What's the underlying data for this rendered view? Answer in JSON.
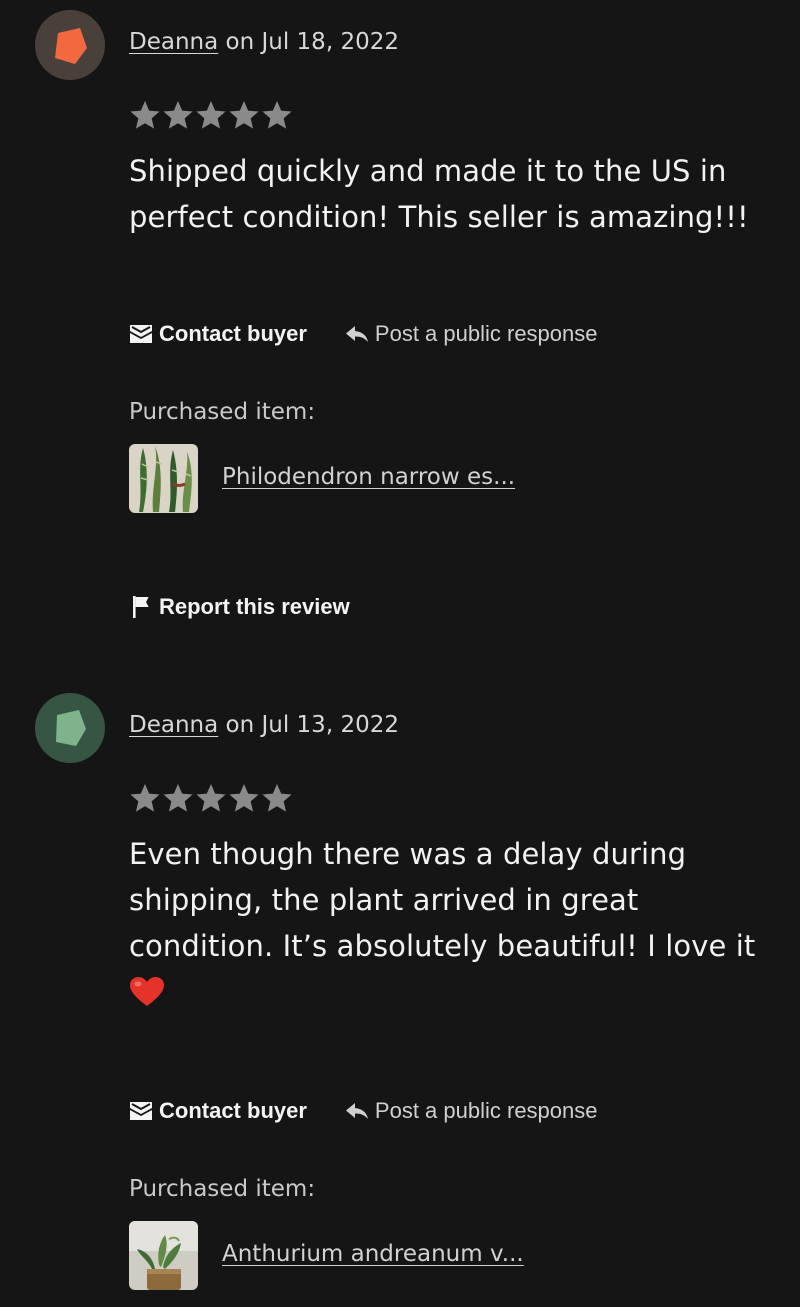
{
  "reviews": [
    {
      "avatar_bg": "#4a403b",
      "avatar_shape": "#f2693f",
      "reviewer": "Deanna",
      "date_text": "on Jul 18, 2022",
      "rating": 5,
      "text": "Shipped quickly and made it to the US in perfect condition! This seller is amazing!!!",
      "contact_label": "Contact buyer",
      "respond_label": "Post a public response",
      "purchased_label": "Purchased item:",
      "item_title": "Philodendron narrow es...",
      "report_label": "Report this review"
    },
    {
      "avatar_bg": "#365543",
      "avatar_shape": "#7eb48c",
      "reviewer": "Deanna",
      "date_text": "on Jul 13, 2022",
      "rating": 5,
      "text": "Even though there was a delay during shipping, the plant arrived in great condition. It’s absolutely beautiful! I love it",
      "contact_label": "Contact buyer",
      "respond_label": "Post a public response",
      "purchased_label": "Purchased item:",
      "item_title": "Anthurium andreanum v..."
    }
  ],
  "colors": {
    "background": "#151515",
    "star": "#8a8a8a",
    "heart": "#e5332a"
  },
  "icons": [
    "envelope-icon",
    "reply-arrow-icon",
    "flag-icon",
    "star-icon",
    "heart-emoji"
  ]
}
